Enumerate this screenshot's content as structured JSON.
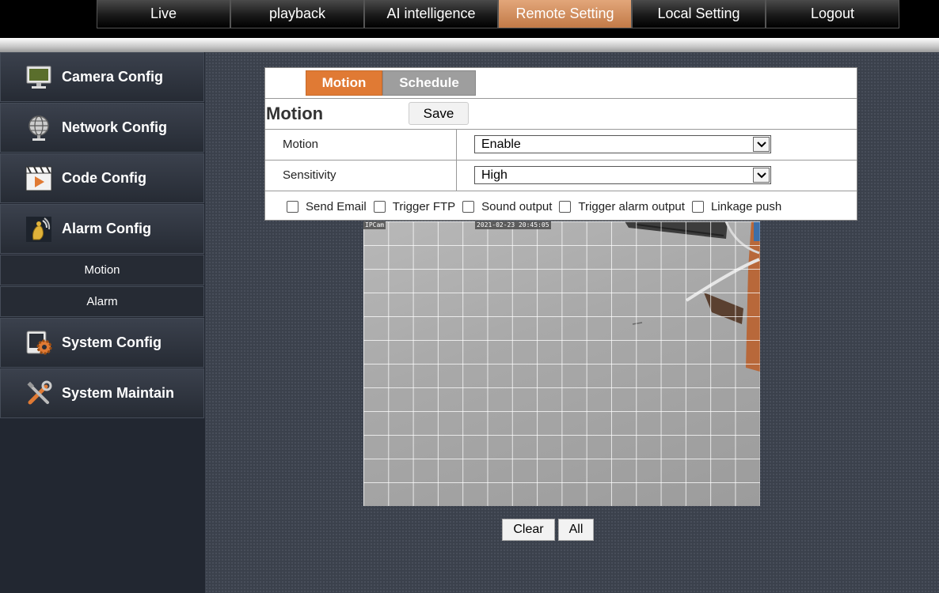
{
  "topnav": {
    "items": [
      {
        "label": "Live",
        "active": false
      },
      {
        "label": "playback",
        "active": false
      },
      {
        "label": "AI intelligence",
        "active": false
      },
      {
        "label": "Remote Setting",
        "active": true
      },
      {
        "label": "Local Setting",
        "active": false
      },
      {
        "label": "Logout",
        "active": false
      }
    ]
  },
  "sidebar": {
    "items": [
      {
        "label": "Camera Config",
        "icon": "monitor-icon"
      },
      {
        "label": "Network Config",
        "icon": "globe-icon"
      },
      {
        "label": "Code Config",
        "icon": "film-icon"
      },
      {
        "label": "Alarm Config",
        "icon": "alarm-icon"
      },
      {
        "label": "System Config",
        "icon": "gear-icon"
      },
      {
        "label": "System Maintain",
        "icon": "tools-icon"
      }
    ],
    "alarm_sub": [
      "Motion",
      "Alarm"
    ]
  },
  "panel": {
    "tabs": [
      "Motion",
      "Schedule"
    ],
    "title": "Motion",
    "save_label": "Save",
    "fields": [
      {
        "label": "Motion",
        "value": "Enable"
      },
      {
        "label": "Sensitivity",
        "value": "High"
      }
    ],
    "checks": [
      "Send Email",
      "Trigger FTP",
      "Sound output",
      "Trigger alarm output",
      "Linkage push"
    ]
  },
  "video": {
    "camera_label": "IPCam",
    "timestamp": "2021-02-23 20:45:05"
  },
  "buttons": {
    "clear": "Clear",
    "all": "All"
  },
  "colors": {
    "accent": "#e07a34",
    "active_nav": "#c27a47",
    "sidebar": "#262b34"
  }
}
